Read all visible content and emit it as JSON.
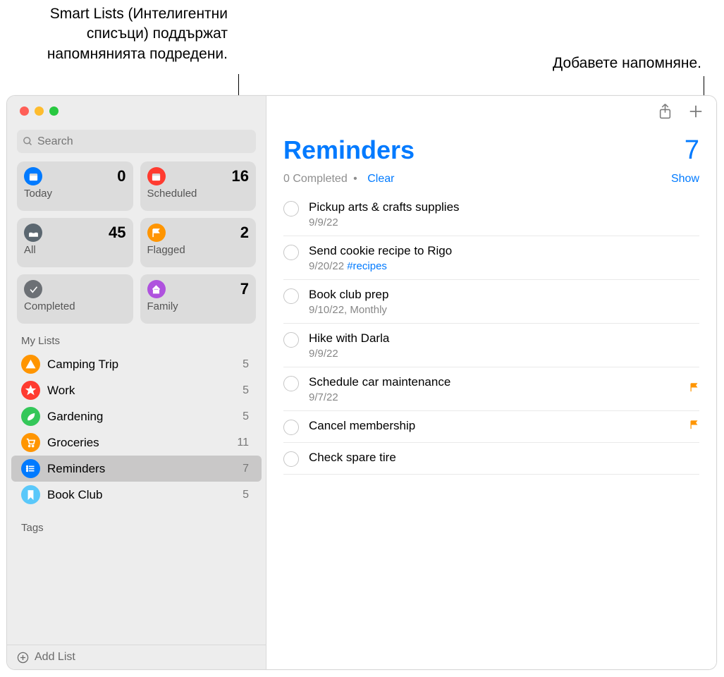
{
  "callouts": {
    "left": "Smart Lists (Интелигентни списъци) поддържат напомнянията подредени.",
    "right": "Добавете напомняне."
  },
  "search": {
    "placeholder": "Search"
  },
  "smart": [
    {
      "label": "Today",
      "count": 0,
      "color": "#007aff",
      "icon": "calendar"
    },
    {
      "label": "Scheduled",
      "count": 16,
      "color": "#ff3b30",
      "icon": "calendar"
    },
    {
      "label": "All",
      "count": 45,
      "color": "#5b6770",
      "icon": "tray"
    },
    {
      "label": "Flagged",
      "count": 2,
      "color": "#ff9500",
      "icon": "flag"
    },
    {
      "label": "Completed",
      "count": "",
      "color": "#6c7075",
      "icon": "check"
    },
    {
      "label": "Family",
      "count": 7,
      "color": "#af52de",
      "icon": "house"
    }
  ],
  "myListsHeader": "My Lists",
  "lists": [
    {
      "name": "Camping Trip",
      "count": 5,
      "color": "#ff9500",
      "icon": "tent"
    },
    {
      "name": "Work",
      "count": 5,
      "color": "#ff3b30",
      "icon": "star"
    },
    {
      "name": "Gardening",
      "count": 5,
      "color": "#34c759",
      "icon": "leaf"
    },
    {
      "name": "Groceries",
      "count": 11,
      "color": "#ff9500",
      "icon": "cart"
    },
    {
      "name": "Reminders",
      "count": 7,
      "color": "#007aff",
      "icon": "list",
      "selected": true
    },
    {
      "name": "Book Club",
      "count": 5,
      "color": "#5ac8fa",
      "icon": "bookmark"
    }
  ],
  "tagsHeader": "Tags",
  "addList": "Add List",
  "main": {
    "title": "Reminders",
    "count": 7,
    "completed": "0 Completed",
    "clear": "Clear",
    "show": "Show",
    "sep": "•"
  },
  "items": [
    {
      "title": "Pickup arts & crafts supplies",
      "meta": "9/9/22"
    },
    {
      "title": "Send cookie recipe to Rigo",
      "meta": "9/20/22",
      "tag": "#recipes"
    },
    {
      "title": "Book club prep",
      "meta": "9/10/22, Monthly"
    },
    {
      "title": "Hike with Darla",
      "meta": "9/9/22"
    },
    {
      "title": "Schedule car maintenance",
      "meta": "9/7/22",
      "flagged": true
    },
    {
      "title": "Cancel membership",
      "meta": "",
      "flagged": true
    },
    {
      "title": "Check spare tire",
      "meta": ""
    }
  ]
}
